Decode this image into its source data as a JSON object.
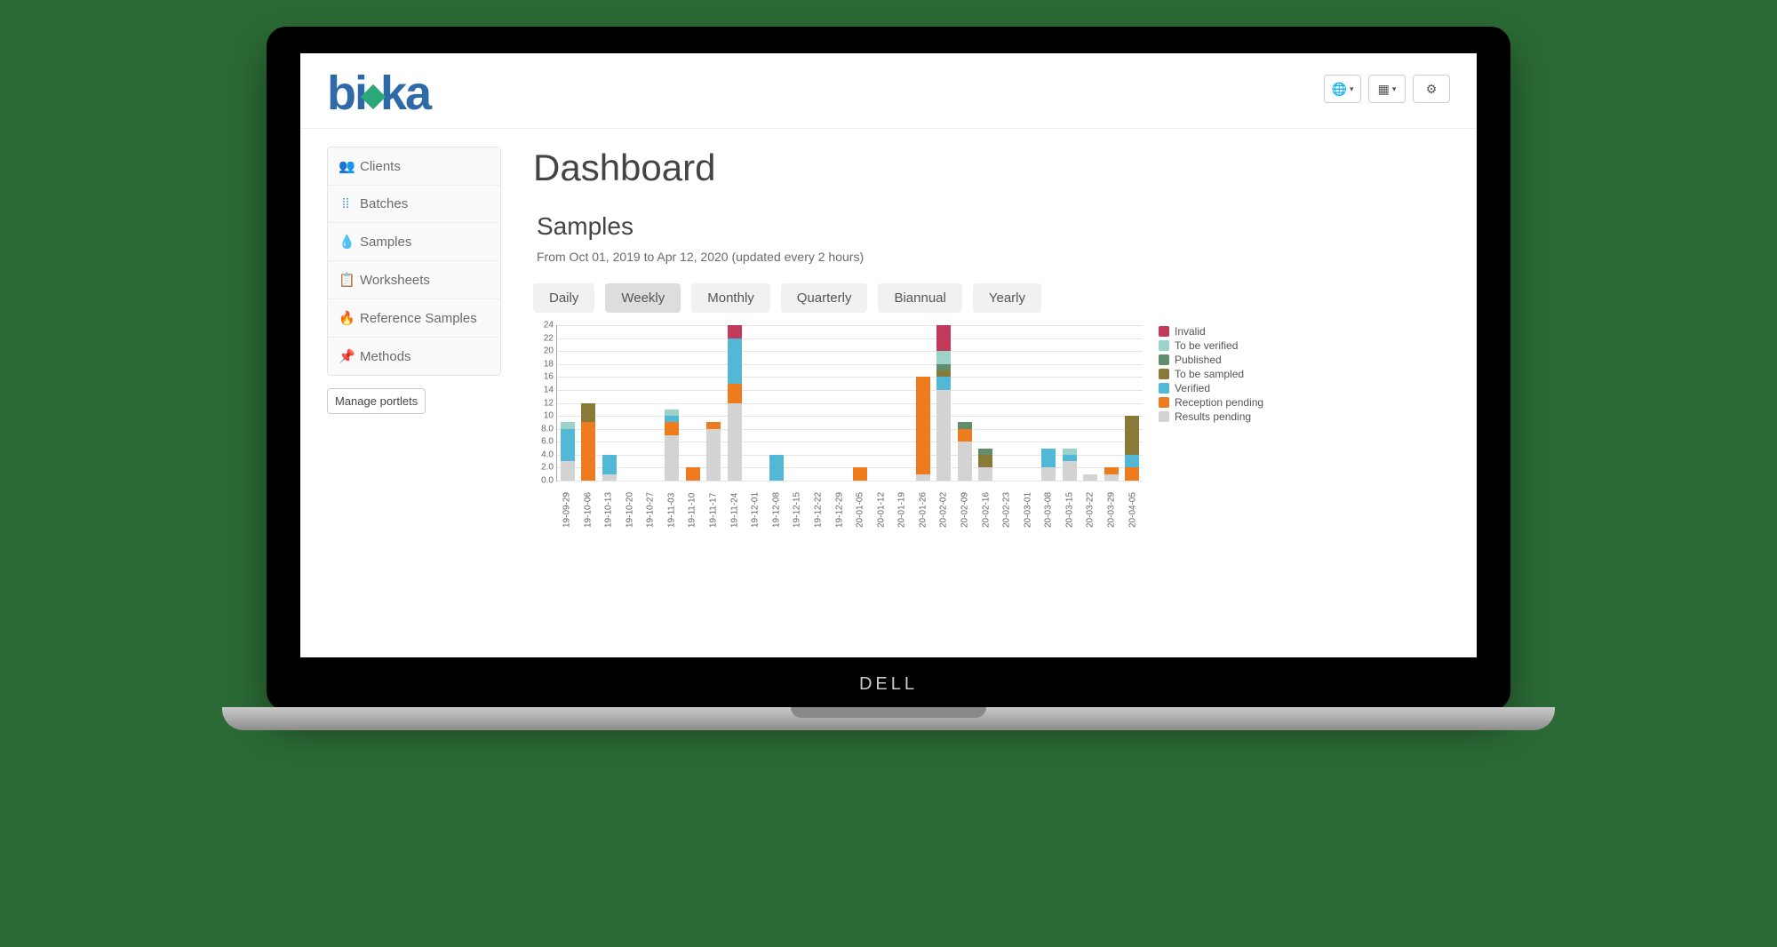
{
  "header": {
    "logo_text_left": "b",
    "logo_text_mid": "i",
    "logo_text_right": "ka"
  },
  "sidebar": {
    "items": [
      {
        "label": "Clients",
        "icon": "👥",
        "icon_color": "#2e8b57"
      },
      {
        "label": "Batches",
        "icon": "⁞⁞",
        "icon_color": "#3b82c4"
      },
      {
        "label": "Samples",
        "icon": "💧",
        "icon_color": "#6a3fb5"
      },
      {
        "label": "Worksheets",
        "icon": "📋",
        "icon_color": "#888888"
      },
      {
        "label": "Reference Samples",
        "icon": "🔥",
        "icon_color": "#d97a1f"
      },
      {
        "label": "Methods",
        "icon": "📌",
        "icon_color": "#555555"
      }
    ],
    "manage_portlets_label": "Manage portlets"
  },
  "main": {
    "title": "Dashboard",
    "section_title": "Samples",
    "subtitle": "From  Oct 01, 2019  to  Apr 12, 2020 (updated every 2 hours)",
    "periods": [
      {
        "label": "Daily",
        "active": false
      },
      {
        "label": "Weekly",
        "active": true
      },
      {
        "label": "Monthly",
        "active": false
      },
      {
        "label": "Quarterly",
        "active": false
      },
      {
        "label": "Biannual",
        "active": false
      },
      {
        "label": "Yearly",
        "active": false
      }
    ]
  },
  "colors": {
    "Invalid": "#c23a5a",
    "To be verified": "#9bd3c9",
    "Published": "#5f8d6e",
    "To be sampled": "#8a7a3a",
    "Verified": "#53b7d6",
    "Reception pending": "#ef7b1f",
    "Results pending": "#d3d3d3"
  },
  "chart_data": {
    "type": "bar",
    "stacked": true,
    "title": "Samples",
    "xlabel": "",
    "ylabel": "",
    "ylim": [
      0,
      24
    ],
    "yticks": [
      0.0,
      2.0,
      4.0,
      6.0,
      8.0,
      10,
      12,
      14,
      16,
      18,
      20,
      22,
      24
    ],
    "legend_position": "right",
    "categories": [
      "19-09-29",
      "19-10-06",
      "19-10-13",
      "19-10-20",
      "19-10-27",
      "19-11-03",
      "19-11-10",
      "19-11-17",
      "19-11-24",
      "19-12-01",
      "19-12-08",
      "19-12-15",
      "19-12-22",
      "19-12-29",
      "20-01-05",
      "20-01-12",
      "20-01-19",
      "20-01-26",
      "20-02-02",
      "20-02-09",
      "20-02-16",
      "20-02-23",
      "20-03-01",
      "20-03-08",
      "20-03-15",
      "20-03-22",
      "20-03-29",
      "20-04-05"
    ],
    "legend_order": [
      "Invalid",
      "To be verified",
      "Published",
      "To be sampled",
      "Verified",
      "Reception pending",
      "Results pending"
    ],
    "series": [
      {
        "name": "Results pending",
        "values": [
          3,
          0,
          1,
          0,
          0,
          7,
          0,
          8,
          12,
          0,
          0,
          0,
          0,
          0,
          0,
          0,
          0,
          1,
          14,
          6,
          2,
          0,
          0,
          2,
          3,
          1,
          1,
          0
        ]
      },
      {
        "name": "Reception pending",
        "values": [
          0,
          9,
          0,
          0,
          0,
          2,
          2,
          1,
          3,
          0,
          0,
          0,
          0,
          0,
          2,
          0,
          0,
          15,
          0,
          2,
          0,
          0,
          0,
          0,
          0,
          0,
          1,
          2
        ]
      },
      {
        "name": "Verified",
        "values": [
          5,
          0,
          3,
          0,
          0,
          1,
          0,
          0,
          7,
          0,
          4,
          0,
          0,
          0,
          0,
          0,
          0,
          0,
          2,
          0,
          0,
          0,
          0,
          3,
          1,
          0,
          0,
          2
        ]
      },
      {
        "name": "To be sampled",
        "values": [
          0,
          3,
          0,
          0,
          0,
          0,
          0,
          0,
          0,
          0,
          0,
          0,
          0,
          0,
          0,
          0,
          0,
          0,
          1,
          0,
          2,
          0,
          0,
          0,
          0,
          0,
          0,
          6
        ]
      },
      {
        "name": "Published",
        "values": [
          0,
          0,
          0,
          0,
          0,
          0,
          0,
          0,
          0,
          0,
          0,
          0,
          0,
          0,
          0,
          0,
          0,
          0,
          1,
          1,
          1,
          0,
          0,
          0,
          0,
          0,
          0,
          0
        ]
      },
      {
        "name": "To be verified",
        "values": [
          1,
          0,
          0,
          0,
          0,
          1,
          0,
          0,
          0,
          0,
          0,
          0,
          0,
          0,
          0,
          0,
          0,
          0,
          2,
          0,
          0,
          0,
          0,
          0,
          1,
          0,
          0,
          0
        ]
      },
      {
        "name": "Invalid",
        "values": [
          0,
          0,
          0,
          0,
          0,
          0,
          0,
          0,
          2,
          0,
          0,
          0,
          0,
          0,
          0,
          0,
          0,
          0,
          4,
          0,
          0,
          0,
          0,
          0,
          0,
          0,
          0,
          0
        ]
      }
    ]
  }
}
